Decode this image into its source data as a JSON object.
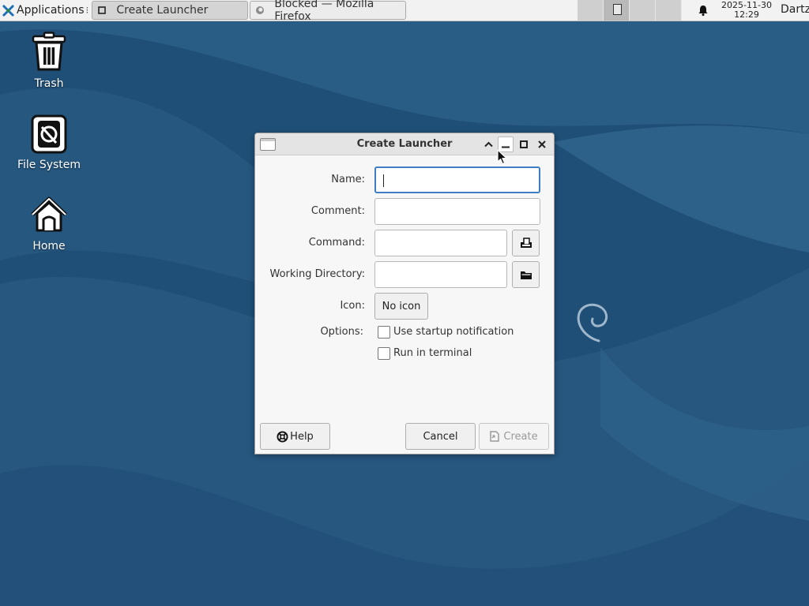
{
  "panel": {
    "applications_label": "Applications",
    "menu_separator": "⁝",
    "tasks": [
      {
        "label": "Create Launcher",
        "active": true
      },
      {
        "label": "Blocked — Mozilla Firefox",
        "active": false
      }
    ],
    "clock_date": "2025-11-30",
    "clock_time": "12:29",
    "user": "Dartz"
  },
  "desktop": {
    "icons": [
      {
        "label": "Trash"
      },
      {
        "label": "File System"
      },
      {
        "label": "Home"
      }
    ]
  },
  "dialog": {
    "title": "Create Launcher",
    "fields": {
      "name_label": "Name:",
      "name_value": "",
      "comment_label": "Comment:",
      "comment_value": "",
      "command_label": "Command:",
      "command_value": "",
      "workdir_label": "Working Directory:",
      "workdir_value": "",
      "icon_label": "Icon:",
      "icon_button": "No icon",
      "options_label": "Options:",
      "startup_notification_label": "Use startup notification",
      "startup_notification_checked": false,
      "run_in_terminal_label": "Run in terminal",
      "run_in_terminal_checked": false
    },
    "buttons": {
      "help": "Help",
      "cancel": "Cancel",
      "create": "Create"
    }
  },
  "colors": {
    "wallpaper": "#1f4f77",
    "focus": "#3f7dc4",
    "panel": "#f2f2f2"
  }
}
